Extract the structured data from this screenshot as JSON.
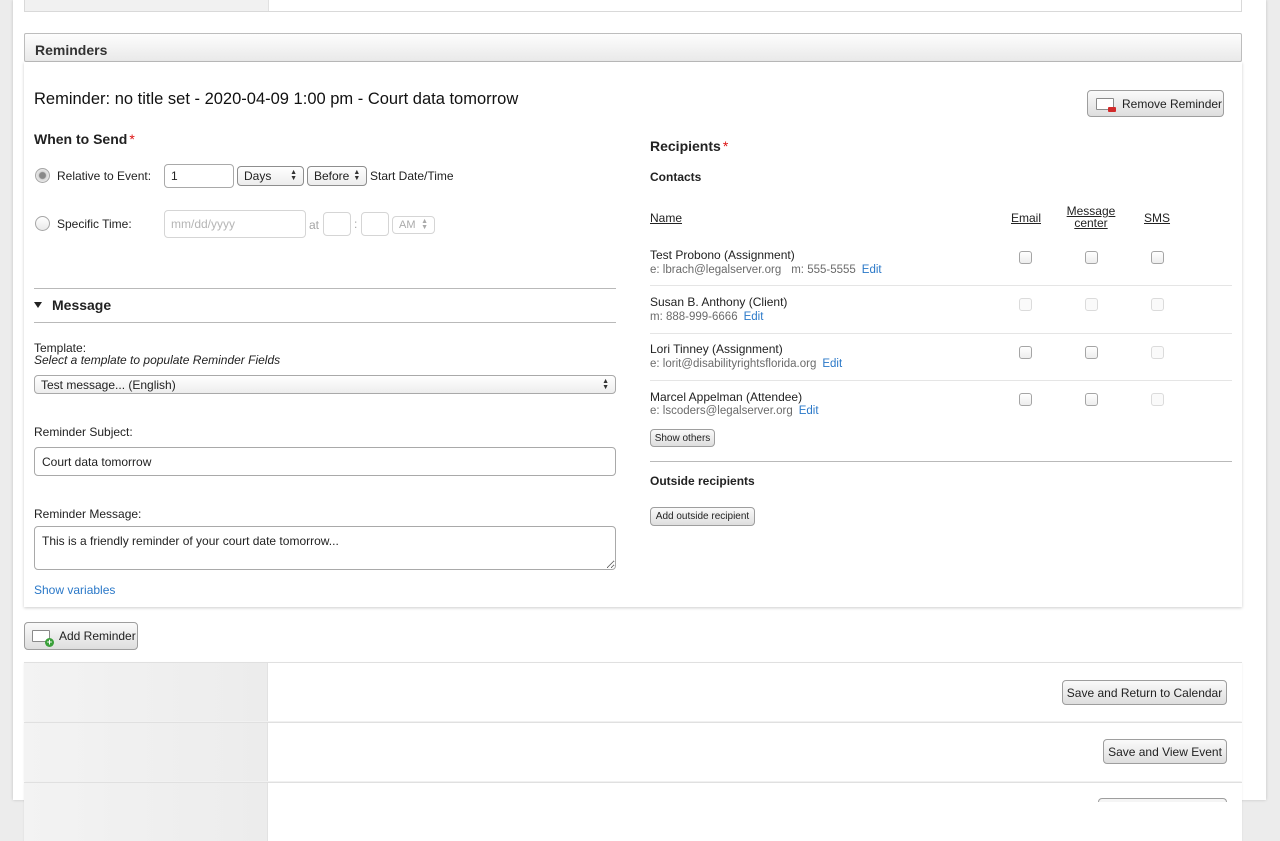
{
  "reminders": {
    "section_title": "Reminders",
    "reminder_title": "Reminder: no title set - 2020-04-09 1:00 pm - Court data tomorrow",
    "remove_label": "Remove Reminder",
    "when_to_send": {
      "heading": "When to Send",
      "required_mark": "*",
      "relative_label": "Relative to Event:",
      "relative_value": "1",
      "unit_selected": "Days",
      "direction_selected": "Before",
      "relative_suffix": "Start Date/Time",
      "specific_label": "Specific Time:",
      "date_placeholder": "mm/dd/yyyy",
      "at_label": "at",
      "time_separator": ":",
      "ampm_selected": "AM"
    },
    "message": {
      "heading": "Message",
      "template_label": "Template:",
      "template_hint": "Select a template to populate Reminder Fields",
      "template_selected": "Test message... (English)",
      "subject_label": "Reminder Subject:",
      "subject_value": "Court data tomorrow",
      "message_label": "Reminder Message:",
      "message_value": "This is a friendly reminder of your court date tomorrow...",
      "show_variables": "Show variables"
    },
    "recipients": {
      "heading": "Recipients",
      "required_mark": "*",
      "contacts_label": "Contacts",
      "columns": {
        "name": "Name",
        "email": "Email",
        "message_center_line1": "Message",
        "message_center_line2": "center",
        "sms": "SMS"
      },
      "contacts": [
        {
          "name": "Test Probono (Assignment)",
          "email_info": "e: lbrach@legalserver.org",
          "phone_info": "m: 555-5555",
          "edit": "Edit"
        },
        {
          "name": "Susan B. Anthony (Client)",
          "email_info": "",
          "phone_info": "m: 888-999-6666",
          "edit": "Edit"
        },
        {
          "name": "Lori Tinney (Assignment)",
          "email_info": "e: lorit@disabilityrightsflorida.org",
          "phone_info": "",
          "edit": "Edit"
        },
        {
          "name": "Marcel Appelman (Attendee)",
          "email_info": "e: lscoders@legalserver.org",
          "phone_info": "",
          "edit": "Edit"
        }
      ],
      "show_others": "Show others",
      "outside_label": "Outside recipients",
      "add_outside": "Add outside recipient"
    }
  },
  "add_reminder": "Add Reminder",
  "actions": {
    "save_return": "Save and Return to Calendar",
    "save_view": "Save and View Event"
  },
  "colors": {
    "link": "#2a78c8",
    "required": "#dd1111",
    "remove_icon_accent": "#d12a2a",
    "add_icon_accent": "#3aa03a"
  }
}
